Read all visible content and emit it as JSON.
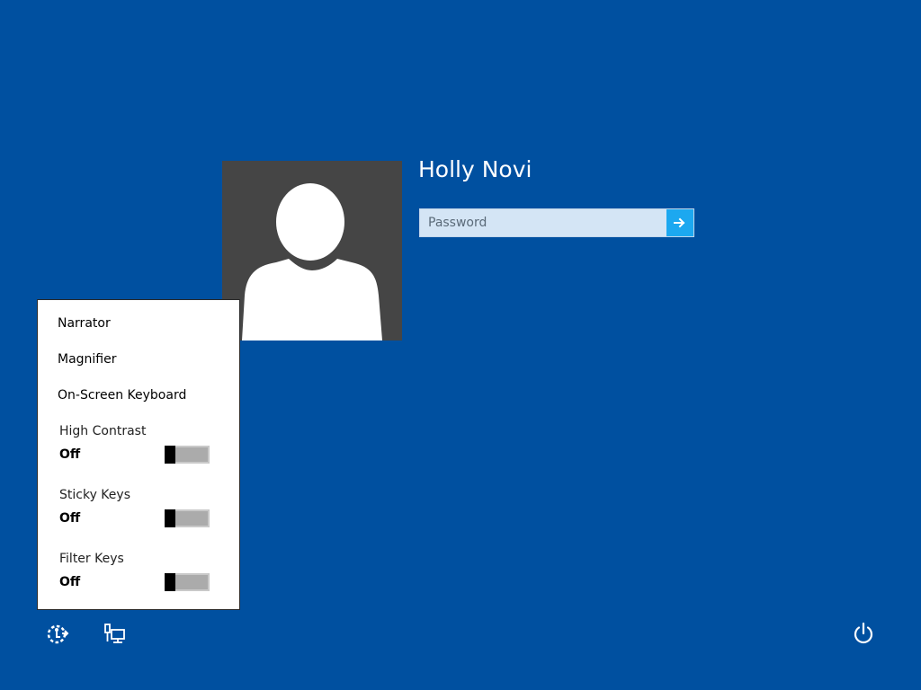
{
  "user": {
    "name": "Holly Novi"
  },
  "password": {
    "placeholder": "Password"
  },
  "ease_of_access": {
    "menu_items": [
      {
        "label": "Narrator"
      },
      {
        "label": "Magnifier"
      },
      {
        "label": "On-Screen Keyboard"
      }
    ],
    "toggles": [
      {
        "label": "High Contrast",
        "state": "Off"
      },
      {
        "label": "Sticky Keys",
        "state": "Off"
      },
      {
        "label": "Filter Keys",
        "state": "Off"
      }
    ]
  },
  "colors": {
    "background": "#0050a0",
    "avatar_bg": "#454545",
    "submit_accent": "#1ca8f0",
    "password_bg": "#d4e5f5"
  },
  "icons": {
    "submit": "arrow-right-icon",
    "ease_of_access": "ease-of-access-icon",
    "network": "network-icon",
    "power": "power-icon"
  }
}
